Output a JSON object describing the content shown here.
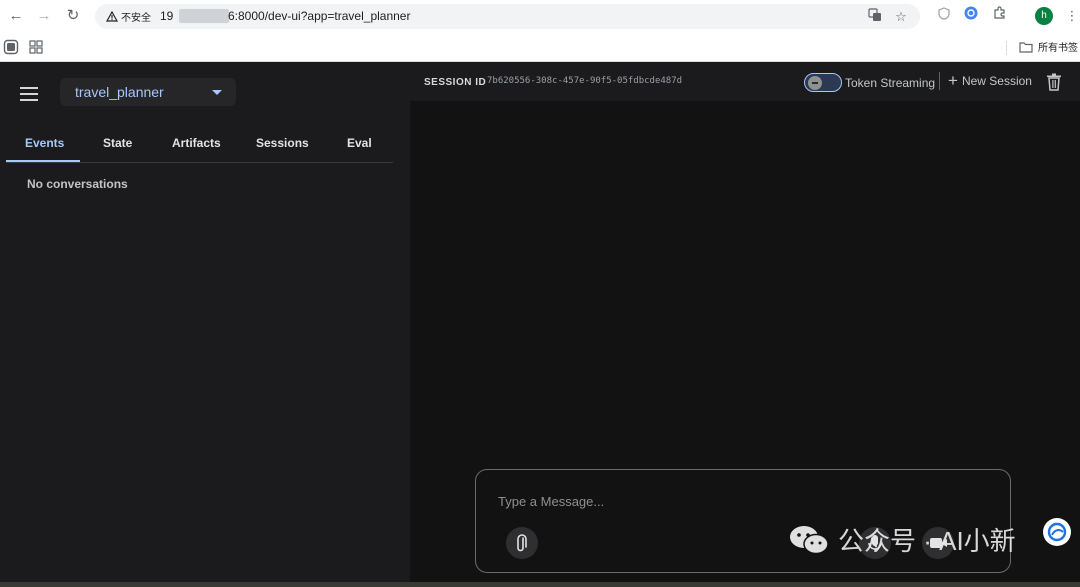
{
  "browser": {
    "security_label": "不安全",
    "url_host": "19",
    "url_path": "6:8000/dev-ui?app=travel_planner",
    "avatar_initial": "h",
    "bookmarks_folder": "所有书签"
  },
  "sidebar": {
    "app_selected": "travel_planner",
    "tabs": [
      {
        "label": "Events",
        "active": true
      },
      {
        "label": "State",
        "active": false
      },
      {
        "label": "Artifacts",
        "active": false
      },
      {
        "label": "Sessions",
        "active": false
      },
      {
        "label": "Eval",
        "active": false
      }
    ],
    "empty_message": "No conversations"
  },
  "header": {
    "session_label": "SESSION ID",
    "session_id": "7b620556-308c-457e-90f5-05fdbcde487d",
    "token_streaming_label": "Token Streaming",
    "token_streaming_on": false,
    "new_session_label": "New Session"
  },
  "composer": {
    "placeholder": "Type a Message..."
  },
  "watermark": {
    "text": "公众号 · AI小新"
  },
  "colors": {
    "accent": "#a8c7fa",
    "sidebar_bg": "#1b1b1d",
    "main_bg": "#121212"
  },
  "icons": [
    "back-icon",
    "forward-icon",
    "reload-icon",
    "warning-icon",
    "translate-icon",
    "star-icon",
    "shield-icon",
    "extension-icon",
    "puzzle-icon",
    "menu-icon",
    "sidebar-toggle-icon",
    "apps-grid-icon",
    "folder-icon",
    "hamburger-icon",
    "dropdown-caret-icon",
    "plus-icon",
    "trash-icon",
    "paperclip-icon",
    "microphone-icon",
    "video-icon",
    "wechat-icon"
  ]
}
